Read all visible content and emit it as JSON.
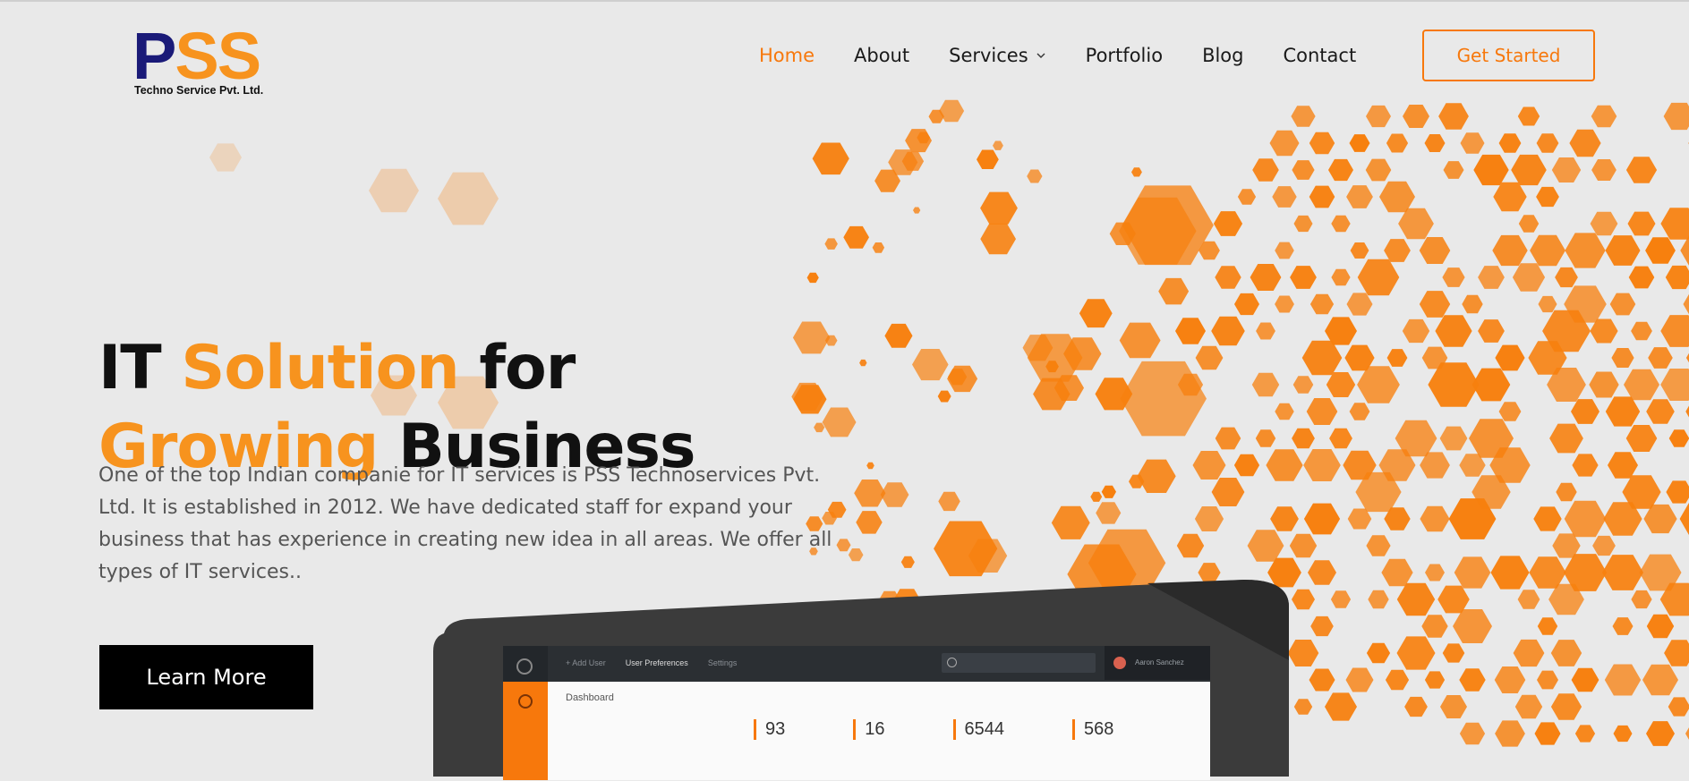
{
  "brand": {
    "mark_p": "P",
    "mark_ss": "SS",
    "tagline": "Techno Service Pvt. Ltd.",
    "colors": {
      "navy": "#1a1a78",
      "orange": "#f7931e",
      "accent": "#f7780c"
    }
  },
  "nav": {
    "items": [
      {
        "label": "Home",
        "active": true
      },
      {
        "label": "About",
        "active": false
      },
      {
        "label": "Services",
        "active": false,
        "has_dropdown": true,
        "icon": "chevron-down-icon"
      },
      {
        "label": "Portfolio",
        "active": false
      },
      {
        "label": "Blog",
        "active": false
      },
      {
        "label": "Contact",
        "active": false
      }
    ],
    "cta_label": "Get Started"
  },
  "hero": {
    "title_parts": [
      "IT ",
      "Solution",
      " for ",
      "Growing",
      " Business"
    ],
    "description": "One of the top Indian companie for IT services is PSS Technoservices Pvt. Ltd. It is established in 2012. We have dedicated staff for expand your business that has experience in creating new idea in all areas. We offer all types of IT services..",
    "button_label": "Learn More"
  },
  "mockup": {
    "tabs": [
      "+ Add User",
      "User Preferences",
      "Settings"
    ],
    "user_name": "Aaron Sanchez",
    "breadcrumb": "Dashboard",
    "stats": [
      "93",
      "16",
      "6544",
      "568"
    ]
  }
}
